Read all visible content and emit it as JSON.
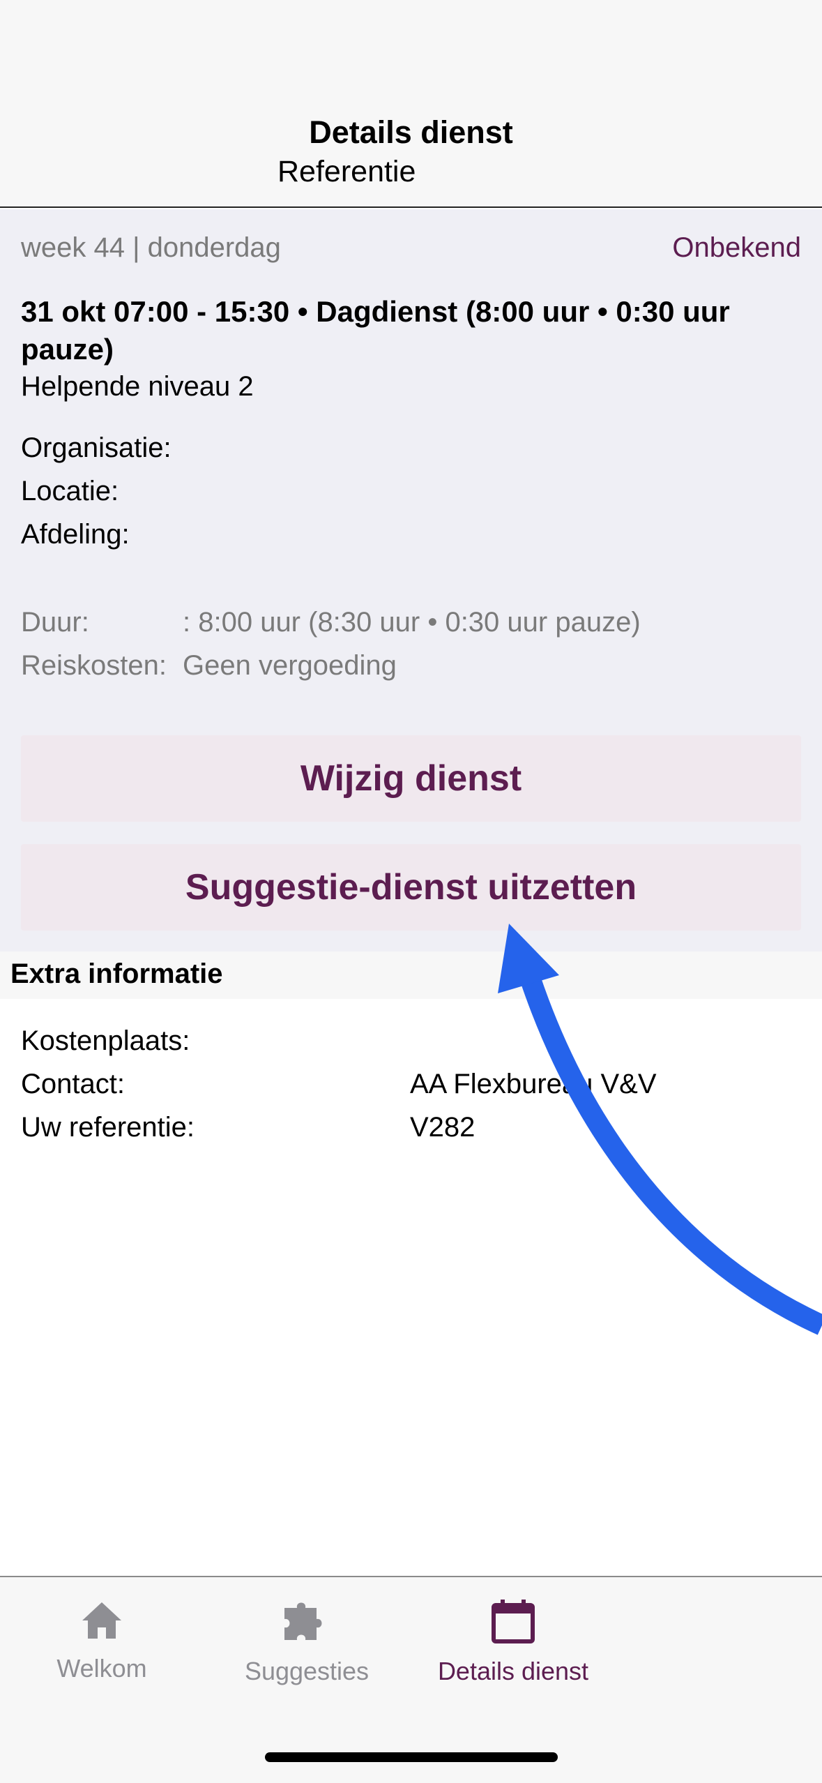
{
  "header": {
    "title": "Details dienst",
    "subtitle": "Referentie"
  },
  "shift": {
    "week_day": "week 44 | donderdag",
    "status": "Onbekend",
    "title": "31 okt 07:00 - 15:30 • Dagdienst (8:00 uur • 0:30 uur pauze)",
    "role": "Helpende niveau 2",
    "organisation_label": "Organisatie:",
    "location_label": "Locatie:",
    "department_label": "Afdeling:",
    "duration_label": "Duur:",
    "duration_value": ": 8:00 uur (8:30 uur • 0:30 uur pauze)",
    "travel_label": "Reiskosten:",
    "travel_value": "Geen vergoeding",
    "edit_button": "Wijzig dienst",
    "suggest_button": "Suggestie-dienst uitzetten"
  },
  "extra": {
    "heading": "Extra informatie",
    "cost_label": "Kostenplaats:",
    "cost_value": "",
    "contact_label": "Contact:",
    "contact_value": "AA Flexbureau V&V",
    "reference_label": "Uw referentie:",
    "reference_value": "V282"
  },
  "tabbar": {
    "tabs": [
      {
        "label": "Welkom",
        "icon": "home-icon",
        "active": false
      },
      {
        "label": "Suggesties",
        "icon": "puzzle-icon",
        "active": false
      },
      {
        "label": "Details dienst",
        "icon": "calendar-icon",
        "active": true
      }
    ]
  },
  "colors": {
    "accent": "#5c1d50",
    "inactive": "#8e8e93",
    "annotation_arrow": "#2563eb"
  }
}
